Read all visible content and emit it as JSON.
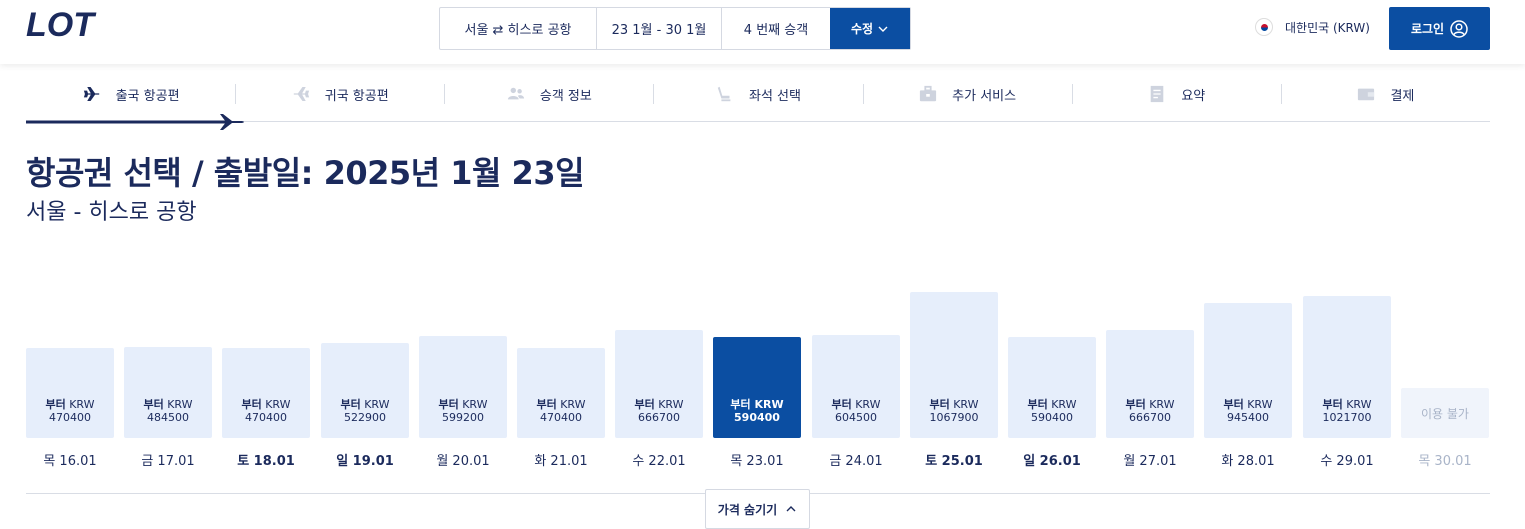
{
  "brand": {
    "logo_text": "LOT",
    "color": "#1b2a5c",
    "accent": "#0b4ea2"
  },
  "search": {
    "route": "서울 ⇄ 히스로 공항",
    "dates": "23 1월 - 30 1월",
    "passengers": "4 번째 승객",
    "edit_label": "수정"
  },
  "locale": {
    "country": "대한민국 (KRW)",
    "flag_icon": "korea-flag-icon"
  },
  "login": {
    "label": "로그인"
  },
  "steps": [
    {
      "label": "출국 항공편",
      "icon": "plane-icon",
      "active": true
    },
    {
      "label": "귀국 항공편",
      "icon": "plane-icon",
      "active": false
    },
    {
      "label": "승객 정보",
      "icon": "people-icon",
      "active": false
    },
    {
      "label": "좌석 선택",
      "icon": "seat-icon",
      "active": false
    },
    {
      "label": "추가 서비스",
      "icon": "briefcase-icon",
      "active": false
    },
    {
      "label": "요약",
      "icon": "document-icon",
      "active": false
    },
    {
      "label": "결제",
      "icon": "wallet-icon",
      "active": false
    }
  ],
  "page": {
    "title": "항공권 선택 / 출발일: 2025년 1월 23일",
    "subtitle": "서울 - 히스로 공항"
  },
  "price_calendar": {
    "from_label": "부터",
    "currency": "KRW",
    "unavailable_label": "이용 불가",
    "days": [
      {
        "date": "목 16.01",
        "price": "470400",
        "weekend": false
      },
      {
        "date": "금 17.01",
        "price": "484500",
        "weekend": false
      },
      {
        "date": "토 18.01",
        "price": "470400",
        "weekend": true
      },
      {
        "date": "일 19.01",
        "price": "522900",
        "weekend": true
      },
      {
        "date": "월 20.01",
        "price": "599200",
        "weekend": false
      },
      {
        "date": "화 21.01",
        "price": "470400",
        "weekend": false
      },
      {
        "date": "수 22.01",
        "price": "666700",
        "weekend": false
      },
      {
        "date": "목 23.01",
        "price": "590400",
        "weekend": false,
        "selected": true
      },
      {
        "date": "금 24.01",
        "price": "604500",
        "weekend": false
      },
      {
        "date": "토 25.01",
        "price": "1067900",
        "weekend": true
      },
      {
        "date": "일 26.01",
        "price": "590400",
        "weekend": true
      },
      {
        "date": "월 27.01",
        "price": "666700",
        "weekend": false
      },
      {
        "date": "화 28.01",
        "price": "945400",
        "weekend": false
      },
      {
        "date": "수 29.01",
        "price": "1021700",
        "weekend": false
      },
      {
        "date": "목 30.01",
        "price": null,
        "weekend": false,
        "unavailable": true
      }
    ]
  },
  "toggle": {
    "label": "가격 숨기기"
  }
}
